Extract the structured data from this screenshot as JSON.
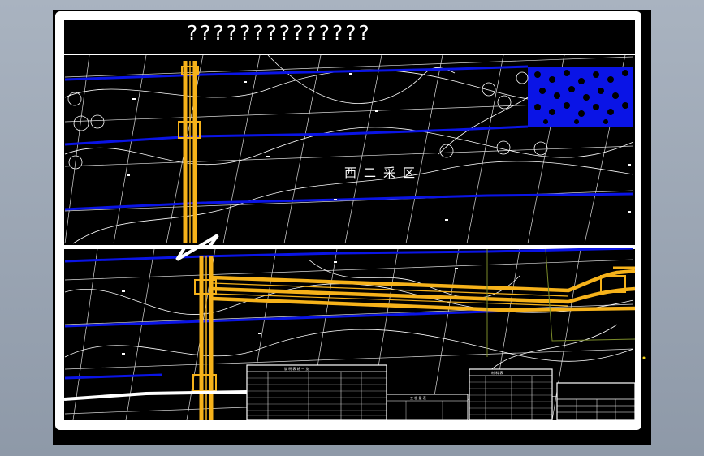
{
  "drawing": {
    "title": "??????????????",
    "zone_label": "西二采区",
    "colors": {
      "background": "#000000",
      "frame": "#ffffff",
      "roadway": "#f6b21a",
      "contour_blue": "#0a14e6",
      "grid_line": "#ffffff",
      "hatch_fill": "#0a14e6",
      "boundary": "#7a8a2a"
    }
  },
  "tables": {
    "left": {
      "header": "说 明 表 格 一 览"
    },
    "middle": {
      "header": "工 程 量 表"
    },
    "right": {
      "header": "材 料 表"
    }
  }
}
